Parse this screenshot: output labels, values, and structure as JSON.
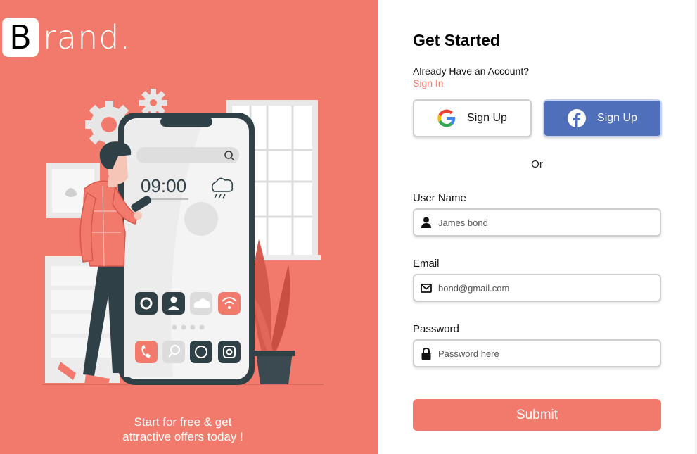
{
  "brand": {
    "initial": "B",
    "rest": "rand."
  },
  "hero": {
    "clock": "09:00",
    "tagline_line1": "Start for free & get",
    "tagline_line2": "attractive offers today !"
  },
  "form": {
    "title": "Get Started",
    "have_account": "Already Have an Account?",
    "sign_in_link": "Sign In",
    "google_button": "Sign Up",
    "facebook_button": "Sign Up",
    "or_text": "Or",
    "username": {
      "label": "User Name",
      "placeholder": "James bond"
    },
    "email": {
      "label": "Email",
      "placeholder": "bond@gmail.com"
    },
    "password": {
      "label": "Password",
      "placeholder": "Password here"
    },
    "submit": "Submit"
  },
  "colors": {
    "accent": "#f27a6c",
    "facebook": "#4f6fba",
    "dark": "#2f4147"
  }
}
